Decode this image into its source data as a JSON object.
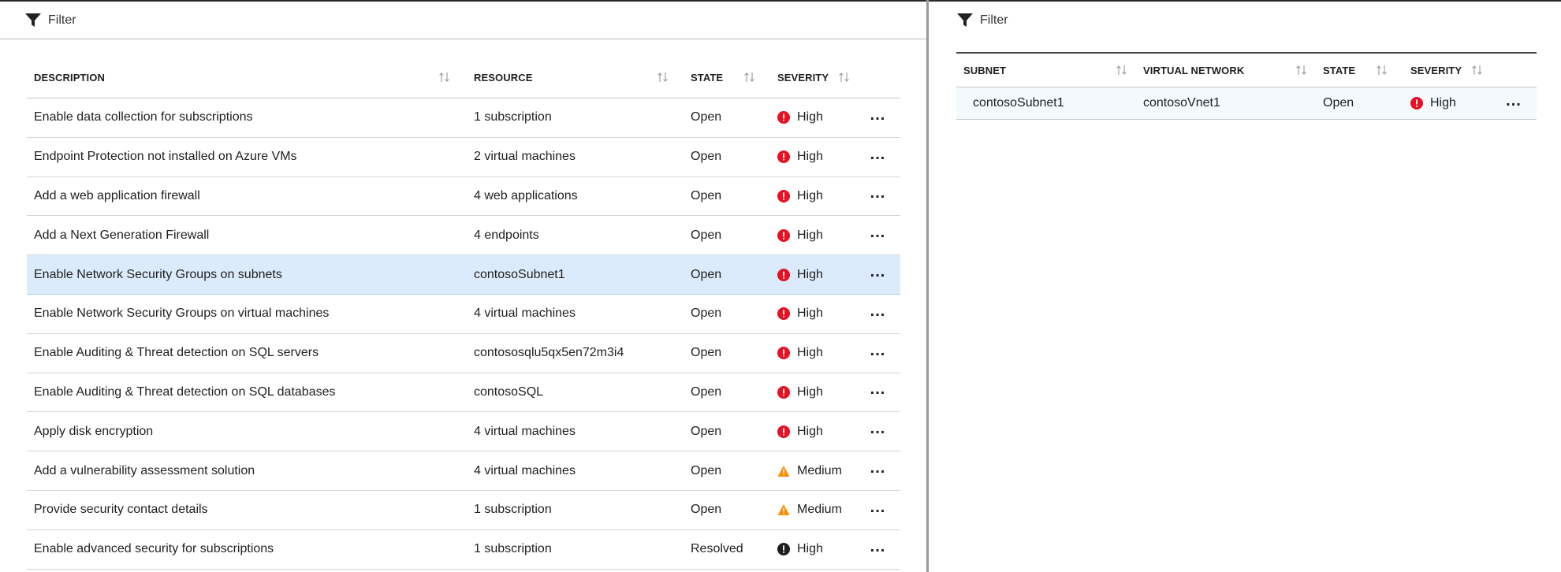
{
  "left": {
    "filter_label": "Filter",
    "columns": [
      "DESCRIPTION",
      "RESOURCE",
      "STATE",
      "SEVERITY"
    ],
    "rows": [
      {
        "description": "Enable data collection for subscriptions",
        "resource": "1 subscription",
        "state": "Open",
        "severity": "High",
        "severity_icon": "error-icon"
      },
      {
        "description": "Endpoint Protection not installed on Azure VMs",
        "resource": "2 virtual machines",
        "state": "Open",
        "severity": "High",
        "severity_icon": "error-icon"
      },
      {
        "description": "Add a web application firewall",
        "resource": "4 web applications",
        "state": "Open",
        "severity": "High",
        "severity_icon": "error-icon"
      },
      {
        "description": "Add a Next Generation Firewall",
        "resource": "4 endpoints",
        "state": "Open",
        "severity": "High",
        "severity_icon": "error-icon"
      },
      {
        "description": "Enable Network Security Groups on subnets",
        "resource": "contosoSubnet1",
        "state": "Open",
        "severity": "High",
        "severity_icon": "error-icon"
      },
      {
        "description": "Enable Network Security Groups on virtual machines",
        "resource": "4 virtual machines",
        "state": "Open",
        "severity": "High",
        "severity_icon": "error-icon"
      },
      {
        "description": "Enable Auditing & Threat detection on SQL servers",
        "resource": "contososqlu5qx5en72m3i4",
        "state": "Open",
        "severity": "High",
        "severity_icon": "error-icon"
      },
      {
        "description": "Enable Auditing & Threat detection on SQL databases",
        "resource": "contosoSQL",
        "state": "Open",
        "severity": "High",
        "severity_icon": "error-icon"
      },
      {
        "description": "Apply disk encryption",
        "resource": "4 virtual machines",
        "state": "Open",
        "severity": "High",
        "severity_icon": "error-icon"
      },
      {
        "description": "Add a vulnerability assessment solution",
        "resource": "4 virtual machines",
        "state": "Open",
        "severity": "Medium",
        "severity_icon": "warning-icon"
      },
      {
        "description": "Provide security contact details",
        "resource": "1 subscription",
        "state": "Open",
        "severity": "Medium",
        "severity_icon": "warning-icon"
      },
      {
        "description": "Enable advanced security for subscriptions",
        "resource": "1 subscription",
        "state": "Resolved",
        "severity": "High",
        "severity_icon": "resolved-icon"
      }
    ],
    "selected_index": 4,
    "more_label": "..."
  },
  "right": {
    "filter_label": "Filter",
    "columns": [
      "SUBNET",
      "VIRTUAL NETWORK",
      "STATE",
      "SEVERITY"
    ],
    "rows": [
      {
        "subnet": "contosoSubnet1",
        "virtual_network": "contosoVnet1",
        "state": "Open",
        "severity": "High",
        "severity_icon": "error-icon"
      }
    ],
    "more_label": "..."
  },
  "colors": {
    "error": "#e81123",
    "warning": "#ff8c00",
    "resolved": "#1f1f1f",
    "selected_row": "#dcebfb"
  }
}
